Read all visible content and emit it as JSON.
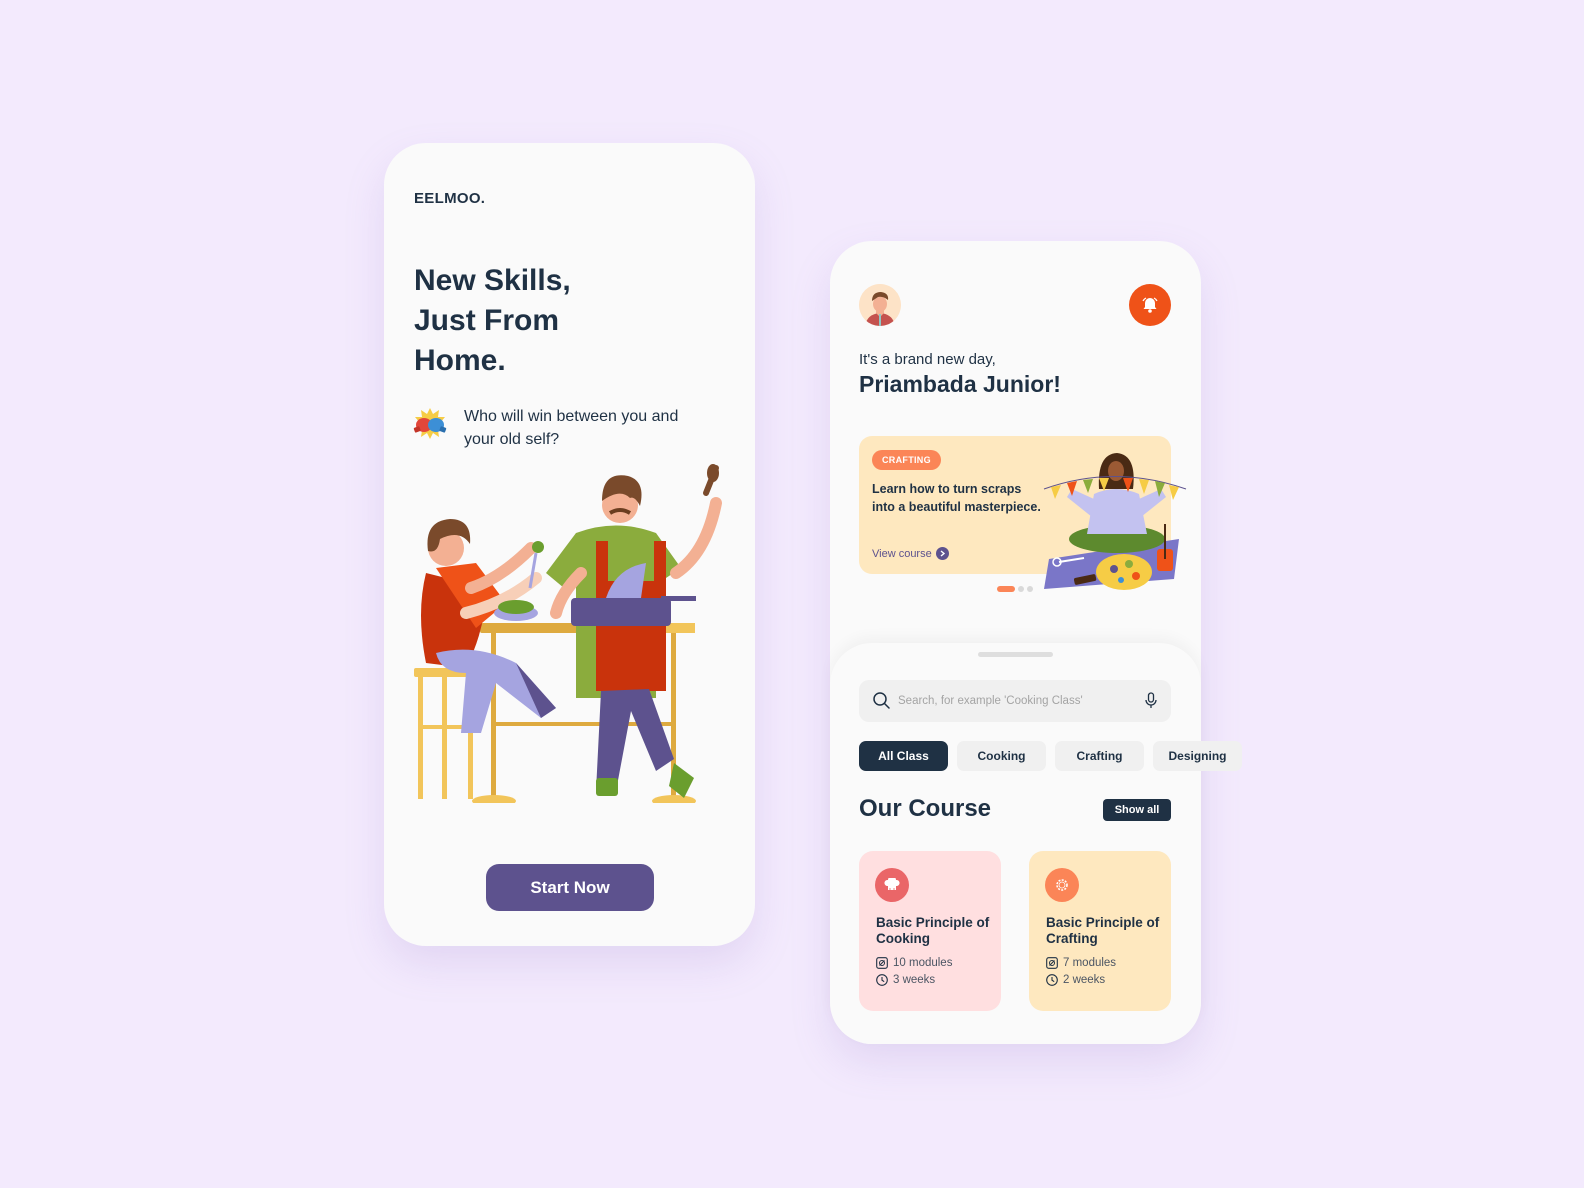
{
  "onboarding": {
    "brand": "EELMOO.",
    "hero_lines": [
      "New Skills,",
      "Just From",
      "Home."
    ],
    "tagline": "Who will win between you and your old self?",
    "tagline_icon": "boxing-gloves-icon",
    "illustration": "cooking-couple-illustration",
    "cta_label": "Start Now"
  },
  "home": {
    "avatar_icon": "user-avatar",
    "notification_icon": "bell-icon",
    "greeting": "It's a brand new day,",
    "user_name": "Priambada Junior!",
    "promo": {
      "tag": "CRAFTING",
      "text": "Learn how to turn scraps into a beautiful masterpiece.",
      "link_label": "View course",
      "illustration": "crafting-woman-illustration",
      "slide_index": 1,
      "slide_count": 3
    },
    "search": {
      "placeholder": "Search, for example 'Cooking Class'",
      "value": ""
    },
    "categories": [
      {
        "label": "All Class",
        "active": true
      },
      {
        "label": "Cooking",
        "active": false
      },
      {
        "label": "Crafting",
        "active": false
      },
      {
        "label": "Designing",
        "active": false
      }
    ],
    "section_title": "Our Course",
    "show_all_label": "Show all",
    "courses": [
      {
        "title": "Basic Principle of Cooking",
        "modules": "10 modules",
        "duration": "3 weeks",
        "icon": "chef-hat-icon",
        "color": "#ea6668",
        "bg": "#ffdfe0"
      },
      {
        "title": "Basic Principle of Crafting",
        "modules": "7 modules",
        "duration": "2 weeks",
        "icon": "crafting-flower-icon",
        "color": "#fb8557",
        "bg": "#fee8bf"
      }
    ]
  },
  "colors": {
    "background": "#f3eafd",
    "primary_dark": "#1f3144",
    "accent_purple": "#5d528e",
    "accent_orange": "#ef5218",
    "promo_bg": "#fee8bf",
    "tag_orange": "#fb8557"
  }
}
